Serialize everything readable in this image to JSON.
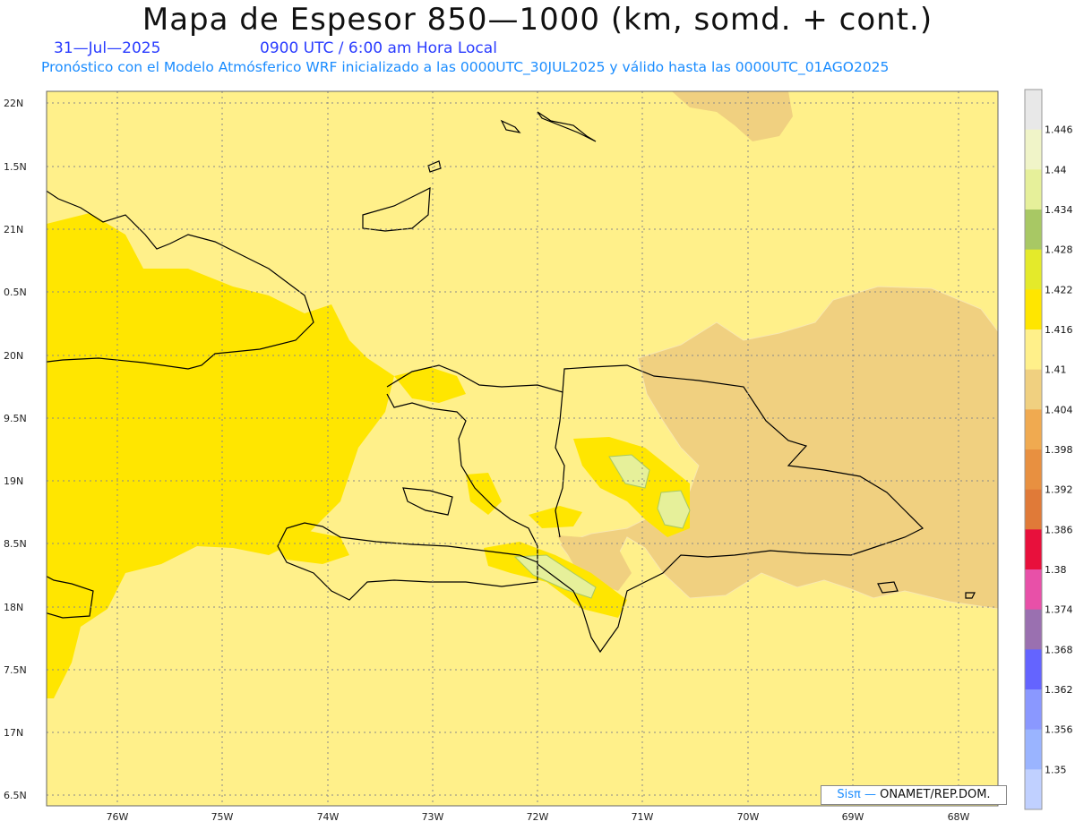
{
  "header": {
    "title": "Mapa de Espesor 850—1000 (km, somd. + cont.)",
    "date": "31—Jul—2025",
    "time": "0900 UTC / 6:00 am Hora Local",
    "model_line": "Pronóstico con el Modelo Atmósferico WRF inicializado a las 0000UTC_30JUL2025 y válido hasta las  0000UTC_01AGO2025"
  },
  "axes": {
    "y_labels": [
      "22N",
      "1.5N",
      "21N",
      "0.5N",
      "20N",
      "9.5N",
      "19N",
      "8.5N",
      "18N",
      "7.5N",
      "17N",
      "6.5N"
    ],
    "x_labels": [
      "76W",
      "75W",
      "74W",
      "73W",
      "72W",
      "71W",
      "70W",
      "69W",
      "68W"
    ]
  },
  "colorbar": {
    "labels": [
      "1.446",
      "1.44",
      "1.434",
      "1.428",
      "1.422",
      "1.416",
      "1.41",
      "1.404",
      "1.398",
      "1.392",
      "1.386",
      "1.38",
      "1.374",
      "1.368",
      "1.362",
      "1.356",
      "1.35"
    ],
    "colors": [
      "#e8e8e8",
      "#f0f4c8",
      "#e6f09a",
      "#a8c864",
      "#e4ea2a",
      "#ffe600",
      "#fff08a",
      "#f0d080",
      "#f0aa50",
      "#e89040",
      "#e07a38",
      "#e8103c",
      "#e850a8",
      "#9a70b0",
      "#6464ff",
      "#8a98ff",
      "#9ab4ff",
      "#c0d0ff"
    ]
  },
  "legend": {
    "credit_a": "Sisπ —",
    "credit_b": "ONAMET/REP.DOM."
  },
  "colors": {
    "base_fill": "#fff08a",
    "lower_fill": "#f0d080",
    "higher_fill": "#ffe600",
    "peak_fill": "#e6f09a",
    "subtitle_blue": "#2a3cff",
    "line_blue": "#1a8cff"
  }
}
